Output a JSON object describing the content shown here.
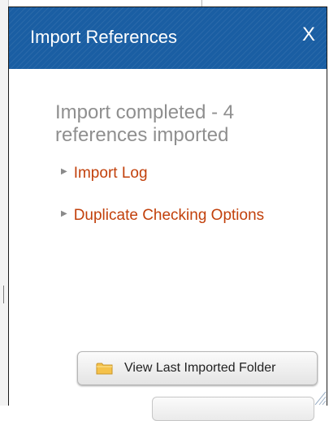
{
  "dialog": {
    "title": "Import References",
    "close_label": "X",
    "status_text": "Import completed - 4 references imported",
    "links": {
      "import_log": "Import Log",
      "duplicate_checking": "Duplicate Checking Options"
    },
    "buttons": {
      "view_last_imported_folder": "View Last Imported Folder"
    }
  },
  "icons": {
    "link_marker": "triangle-right-icon",
    "view_folder": "folder-icon",
    "resize": "resize-grip-icon"
  },
  "colors": {
    "titlebar": "#1a5ea3",
    "status_text": "#8f8f8f",
    "link": "#c2410c"
  }
}
